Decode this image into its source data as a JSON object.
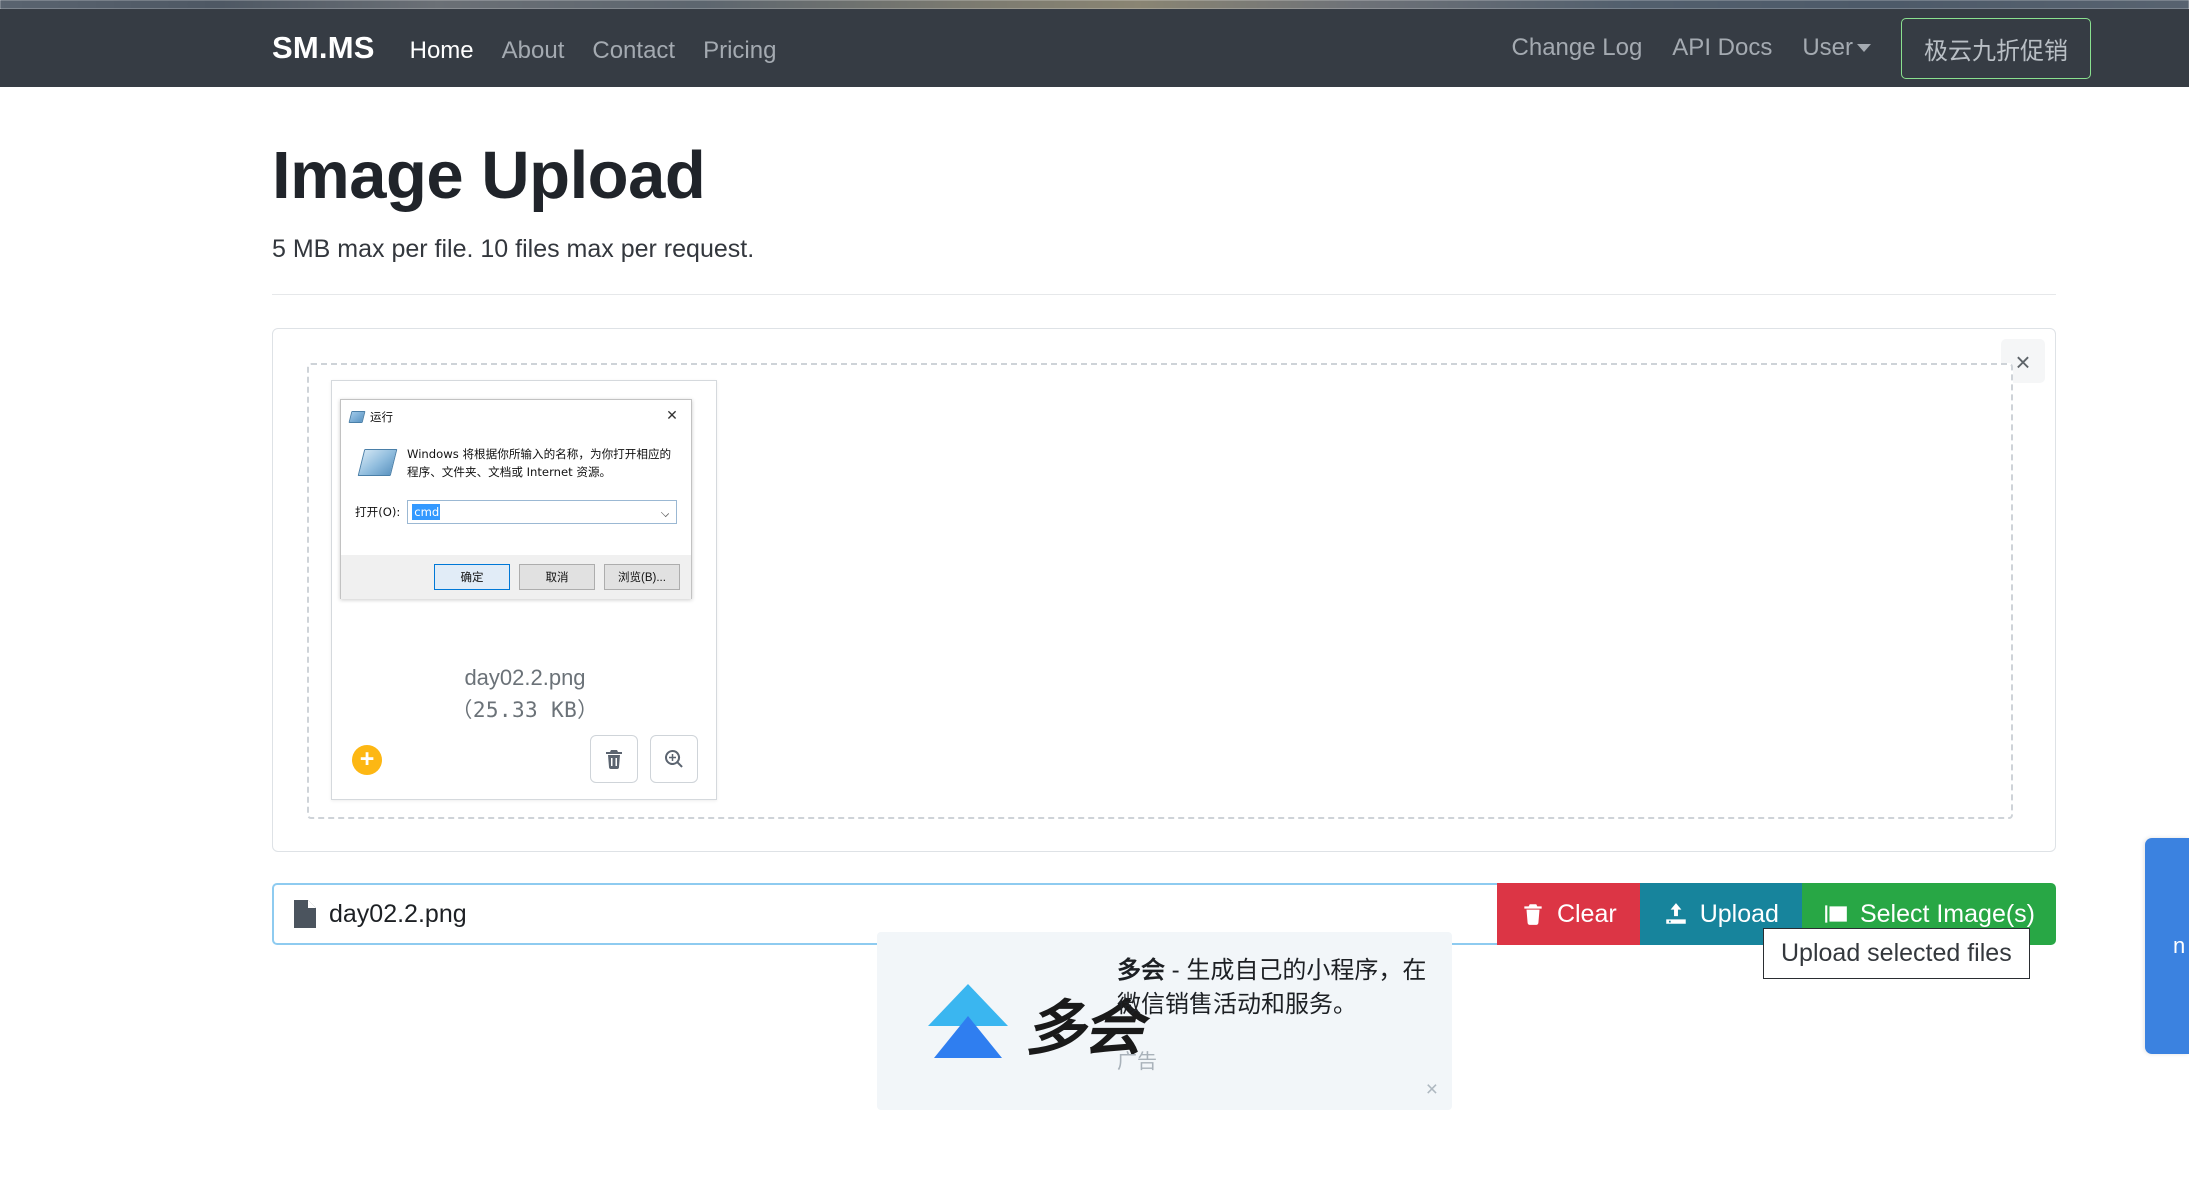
{
  "navbar": {
    "brand": "SM.MS",
    "left_links": [
      {
        "label": "Home",
        "active": true
      },
      {
        "label": "About",
        "active": false
      },
      {
        "label": "Contact",
        "active": false
      },
      {
        "label": "Pricing",
        "active": false
      }
    ],
    "right_links": [
      {
        "label": "Change Log"
      },
      {
        "label": "API Docs"
      },
      {
        "label": "User"
      }
    ],
    "promo_button": "极云九折促销",
    "promo_border_color": "#8ae08f",
    "background_color": "#363c44"
  },
  "page": {
    "title": "Image Upload",
    "subtitle": "5 MB max per file. 10 files max per request."
  },
  "upload_panel": {
    "close_label": "×",
    "thumbnail": {
      "file_name": "day02.2.png",
      "file_size": "（25.33 KB）",
      "add_badge": "+",
      "delete_icon": "trash-icon",
      "preview_icon": "zoom-in-icon"
    },
    "preview_dialog": {
      "title": "运行",
      "title_icon": "run-app-icon",
      "close_label": "✕",
      "message": "Windows 将根据你所输入的名称，为你打开相应的程序、文件夹、文档或 Internet 资源。",
      "open_label": "打开(O):",
      "open_value": "cmd",
      "buttons": [
        {
          "label": "确定",
          "primary": true
        },
        {
          "label": "取消",
          "primary": false
        },
        {
          "label": "浏览(B)...",
          "primary": false
        }
      ]
    }
  },
  "toolbar": {
    "file_name": "day02.2.png",
    "file_icon": "file-icon",
    "clear_label": "Clear",
    "upload_label": "Upload",
    "select_label": "Select Image(s)",
    "clear_color": "#dc3545",
    "upload_color": "#17849c",
    "select_color": "#28a745"
  },
  "tooltip": {
    "text": "Upload selected files"
  },
  "ad": {
    "brand": "多会",
    "wordmark": "多会",
    "separator": " - ",
    "description": "生成自己的小程序，在微信销售活动和服务。",
    "label": "广告",
    "close_label": "×",
    "background_color": "#f2f6f9"
  },
  "side_tab": {
    "label": "n",
    "color": "#3b82e0"
  }
}
